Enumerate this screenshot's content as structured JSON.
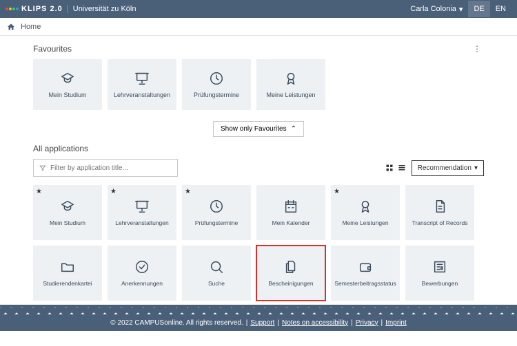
{
  "header": {
    "logo_text": "KLIPS 2.0",
    "university": "Universität zu Köln",
    "user": "Carla Colonia",
    "lang_de": "DE",
    "lang_en": "EN"
  },
  "breadcrumb": {
    "home": "Home"
  },
  "favourites": {
    "title": "Favourites",
    "tiles": [
      {
        "label": "Mein Studium",
        "icon": "graduation"
      },
      {
        "label": "Lehrveranstaltungen",
        "icon": "presentation"
      },
      {
        "label": "Prüfungstermine",
        "icon": "clock"
      },
      {
        "label": "Meine Leistungen",
        "icon": "award"
      }
    ]
  },
  "toggle": {
    "label": "Show only Favourites"
  },
  "all_apps": {
    "title": "All applications",
    "filter_placeholder": "Filter by application title...",
    "reco_label": "Recommendation",
    "tiles": [
      {
        "label": "Mein Studium",
        "icon": "graduation",
        "starred": true
      },
      {
        "label": "Lehrveranstaltungen",
        "icon": "presentation",
        "starred": true
      },
      {
        "label": "Prüfungstermine",
        "icon": "clock",
        "starred": true
      },
      {
        "label": "Mein Kalender",
        "icon": "calendar",
        "starred": false
      },
      {
        "label": "Meine Leistungen",
        "icon": "award",
        "starred": true
      },
      {
        "label": "Transcript of Records",
        "icon": "document",
        "starred": false
      },
      {
        "label": "Studierendenkartei",
        "icon": "folder",
        "starred": false
      },
      {
        "label": "Anerkennungen",
        "icon": "check",
        "starred": false
      },
      {
        "label": "Suche",
        "icon": "search",
        "starred": false
      },
      {
        "label": "Bescheinigungen",
        "icon": "files",
        "starred": false,
        "highlight": true
      },
      {
        "label": "Semesterbeitragsstatus",
        "icon": "wallet",
        "starred": false
      },
      {
        "label": "Bewerbungen",
        "icon": "newspaper",
        "starred": false
      }
    ]
  },
  "footer": {
    "copyright": "© 2022 CAMPUSonline. All rights reserved.",
    "links": [
      "Support",
      "Notes on accessibility",
      "Privacy",
      "Imprint"
    ]
  }
}
